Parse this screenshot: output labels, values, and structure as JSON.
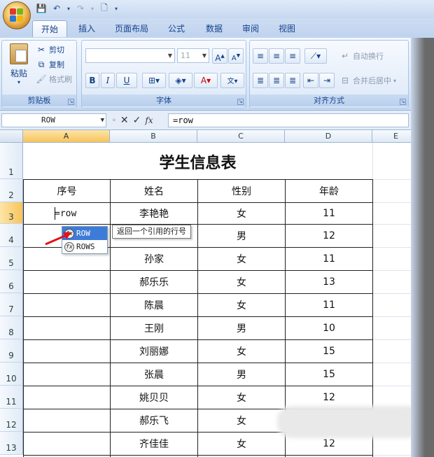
{
  "tabs": [
    {
      "label": "开始",
      "active": true
    },
    {
      "label": "插入"
    },
    {
      "label": "页面布局"
    },
    {
      "label": "公式"
    },
    {
      "label": "数据"
    },
    {
      "label": "审阅"
    },
    {
      "label": "视图"
    }
  ],
  "ribbon": {
    "clipboard": {
      "label": "剪贴板",
      "paste": "粘贴",
      "cut": "剪切",
      "copy": "复制",
      "format_painter": "格式刷"
    },
    "font": {
      "label": "字体",
      "font_size": "11",
      "bold": "B",
      "italic": "I",
      "underline": "U"
    },
    "alignment": {
      "label": "对齐方式",
      "wrap_text": "自动换行",
      "merge_center": "合并后居中"
    }
  },
  "formula_bar": {
    "name_box": "ROW",
    "fx": "fx",
    "content": "=row"
  },
  "sheet": {
    "columns": [
      "A",
      "B",
      "C",
      "D",
      "E"
    ],
    "rows": [
      "1",
      "2",
      "3",
      "4",
      "5",
      "6",
      "7",
      "8",
      "9",
      "10",
      "11",
      "12",
      "13"
    ],
    "title": "学生信息表",
    "headers": [
      "序号",
      "姓名",
      "性别",
      "年龄"
    ],
    "active_cell_text": "=row",
    "data": [
      [
        "李艳艳",
        "女",
        "11"
      ],
      [
        "",
        "男",
        "12"
      ],
      [
        "孙家",
        "女",
        "11"
      ],
      [
        "郝乐乐",
        "女",
        "13"
      ],
      [
        "陈晨",
        "女",
        "11"
      ],
      [
        "王刚",
        "男",
        "10"
      ],
      [
        "刘丽娜",
        "女",
        "15"
      ],
      [
        "张晨",
        "男",
        "15"
      ],
      [
        "姚贝贝",
        "女",
        "12"
      ],
      [
        "郝乐飞",
        "女",
        ""
      ],
      [
        "齐佳佳",
        "女",
        "12"
      ]
    ]
  },
  "autocomplete": {
    "items": [
      "ROW",
      "ROWS"
    ],
    "tooltip": "返回一个引用的行号"
  },
  "colors": {
    "accent": "#3d7bd8",
    "selected_header": "#f7c45c",
    "arrow": "#e0141b"
  }
}
